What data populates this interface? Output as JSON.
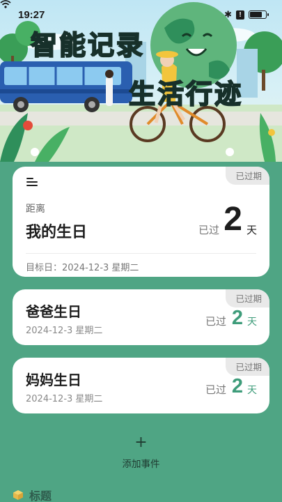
{
  "status_bar": {
    "time": "19:27",
    "icons": [
      "bluetooth-icon",
      "wifi-icon",
      "alert-icon",
      "battery-icon"
    ],
    "alert_glyph": "!"
  },
  "hero": {
    "title_line1": "智能记录",
    "title_line2": "生活行迹"
  },
  "main_card": {
    "badge": "已过期",
    "distance_label": "距离",
    "title": "我的生日",
    "passed_label": "已过",
    "days": "2",
    "unit": "天",
    "target_date": "目标日：2024-12-3 星期二"
  },
  "events": [
    {
      "badge": "已过期",
      "title": "爸爸生日",
      "date": "2024-12-3 星期二",
      "passed_label": "已过",
      "days": "2",
      "unit": "天"
    },
    {
      "badge": "已过期",
      "title": "妈妈生日",
      "date": "2024-12-3 星期二",
      "passed_label": "已过",
      "days": "2",
      "unit": "天"
    }
  ],
  "add_event": {
    "plus": "+",
    "label": "添加事件"
  },
  "bottom_sheet": {
    "label": "标题"
  },
  "colors": {
    "background": "#4fa584",
    "accent_green": "#3e9c7a",
    "badge_bg": "#e9e9e9"
  }
}
